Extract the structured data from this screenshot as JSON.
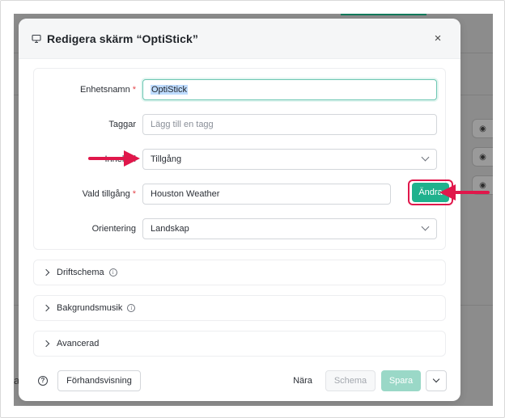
{
  "modal": {
    "title": "Redigera skärm  “OptiStick”",
    "close_label": "×"
  },
  "form": {
    "device_name": {
      "label": "Enhetsnamn",
      "required": "*",
      "value": "OptiStick"
    },
    "tags": {
      "label": "Taggar",
      "placeholder": "Lägg till en tagg"
    },
    "content": {
      "label": "Innehåll",
      "value": "Tillgång"
    },
    "selected_asset": {
      "label": "Vald tillgång",
      "required": "*",
      "value": "Houston Weather",
      "change_button": "Ändra"
    },
    "orientation": {
      "label": "Orientering",
      "value": "Landskap"
    }
  },
  "sections": [
    {
      "label": "Driftschema",
      "has_info": true
    },
    {
      "label": "Bakgrundsmusik",
      "has_info": true
    },
    {
      "label": "Avancerad",
      "has_info": false
    }
  ],
  "footer": {
    "help_icon": "?",
    "preview_button": "Förhandsvisning",
    "close_button": "Nära",
    "schedule_button": "Schema",
    "save_button": "Spara"
  },
  "colors": {
    "accent": "#1fb18d",
    "annotation": "#e0174b",
    "save_disabled": "#9ad8c7",
    "backdrop": "#8c8c8c"
  },
  "icons": [
    "monitor-icon",
    "close-icon",
    "chevron-down-icon",
    "chevron-right-icon",
    "info-icon",
    "help-icon",
    "eye-icon",
    "arrow-annotation"
  ]
}
